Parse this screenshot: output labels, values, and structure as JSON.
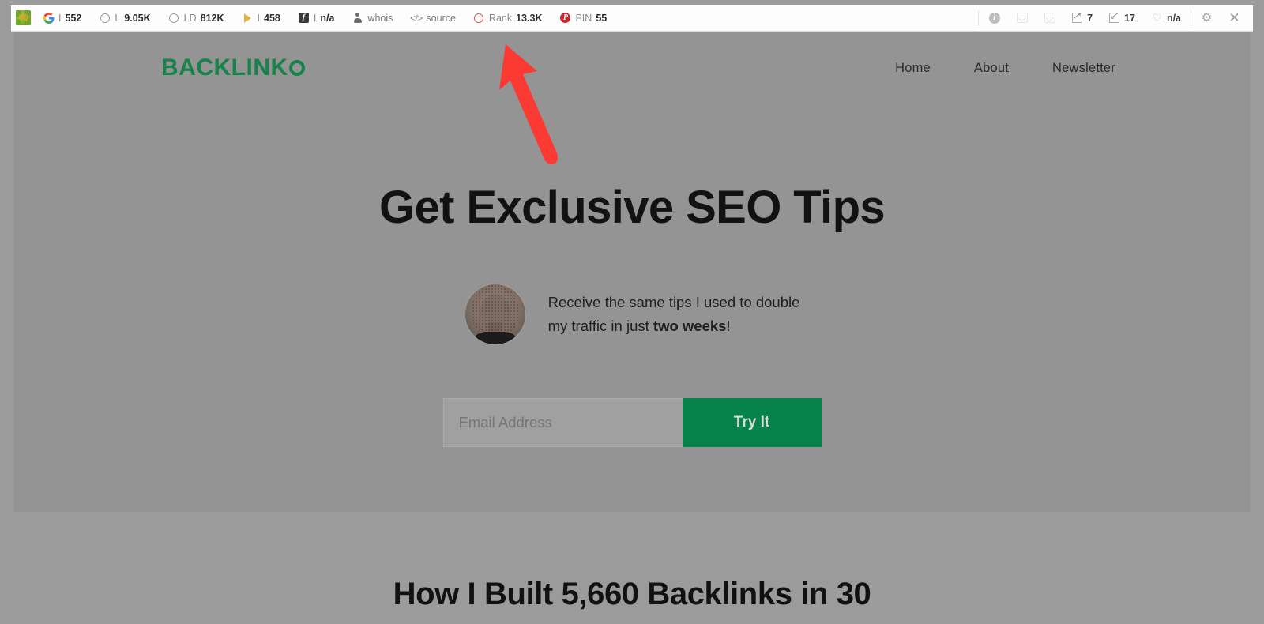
{
  "toolbar": {
    "extension_icon": "seoquake-logo-icon",
    "left_items": [
      {
        "icon": "google-icon",
        "label": "I",
        "value": "552"
      },
      {
        "icon": "circle-icon",
        "label": "L",
        "value": "9.05K"
      },
      {
        "icon": "circle-icon",
        "label": "LD",
        "value": "812K"
      },
      {
        "icon": "bing-icon",
        "label": "I",
        "value": "458"
      },
      {
        "icon": "facebook-icon",
        "label": "I",
        "value": "n/a"
      },
      {
        "icon": "person-icon",
        "label": "whois",
        "value": ""
      },
      {
        "icon": "code-icon",
        "label": "source",
        "value": ""
      },
      {
        "icon": "circle-red-icon",
        "label": "Rank",
        "value": "13.3K"
      },
      {
        "icon": "pinterest-icon",
        "label": "PIN",
        "value": "55"
      }
    ],
    "right_items": [
      {
        "icon": "info-icon",
        "value": ""
      },
      {
        "icon": "page-density-icon",
        "value": ""
      },
      {
        "icon": "keyword-icon",
        "value": ""
      },
      {
        "icon": "external-links-icon",
        "value": "7"
      },
      {
        "icon": "internal-links-icon",
        "value": "17"
      },
      {
        "icon": "health-icon",
        "value": "n/a"
      }
    ],
    "settings_icon": "gear-icon",
    "close_icon": "close-icon"
  },
  "site": {
    "logo_text": "BACKLINK",
    "logo_mark": "o-ring-icon",
    "nav": [
      {
        "label": "Home"
      },
      {
        "label": "About"
      },
      {
        "label": "Newsletter"
      }
    ],
    "hero": {
      "title": "Get Exclusive SEO Tips",
      "pitch_line1": "Receive the same tips I used to double",
      "pitch_line2_prefix": "my traffic in just ",
      "pitch_line2_bold": "two weeks",
      "pitch_line2_suffix": "!",
      "avatar_alt": "author-portrait"
    },
    "signup": {
      "email_placeholder": "Email Address",
      "email_value": "",
      "submit_label": "Try It"
    },
    "next_section_title": "How I Built 5,660 Backlinks in 30"
  },
  "annotation": {
    "arrow_color": "#fb3b33",
    "points_to": "seoquake-toolbar"
  },
  "colors": {
    "brand_green": "#17824a",
    "button_green": "#07824a",
    "page_overlay": "#949494",
    "annotation_red": "#fb3b33"
  }
}
